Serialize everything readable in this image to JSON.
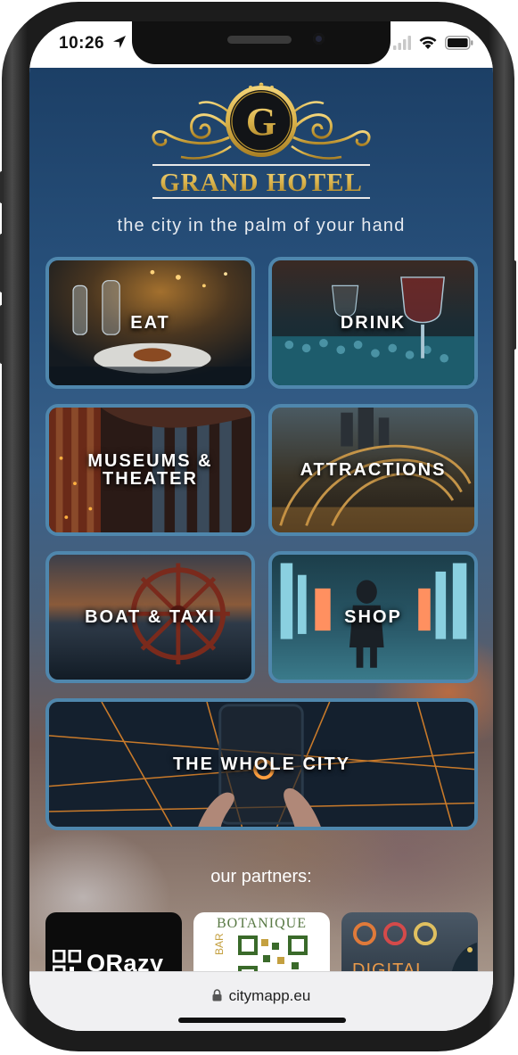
{
  "status_bar": {
    "time": "10:26",
    "icons": [
      "location-arrow-icon",
      "signal-icon",
      "wifi-icon",
      "battery-icon"
    ]
  },
  "logo": {
    "monogram": "G",
    "name": "GRAND HOTEL"
  },
  "tagline": "the city in the palm of your hand",
  "tiles": [
    {
      "label": "EAT"
    },
    {
      "label": "DRINK"
    },
    {
      "label_line1": "MUSEUMS &",
      "label_line2": "THEATER"
    },
    {
      "label": "ATTRACTIONS"
    },
    {
      "label": "BOAT & TAXI"
    },
    {
      "label": "SHOP"
    },
    {
      "label": "THE WHOLE CITY"
    }
  ],
  "partners": {
    "title": "our partners:",
    "items": [
      {
        "name": "QRazy"
      },
      {
        "name_top": "BOTANIQUE",
        "name_side": "BAR"
      },
      {
        "name": "DIGITAL"
      }
    ]
  },
  "browser": {
    "url": "citymapp.eu"
  },
  "colors": {
    "tile_border": "#4f87ad",
    "gold": "#d9b24a",
    "background_top": "#1c3f66"
  }
}
